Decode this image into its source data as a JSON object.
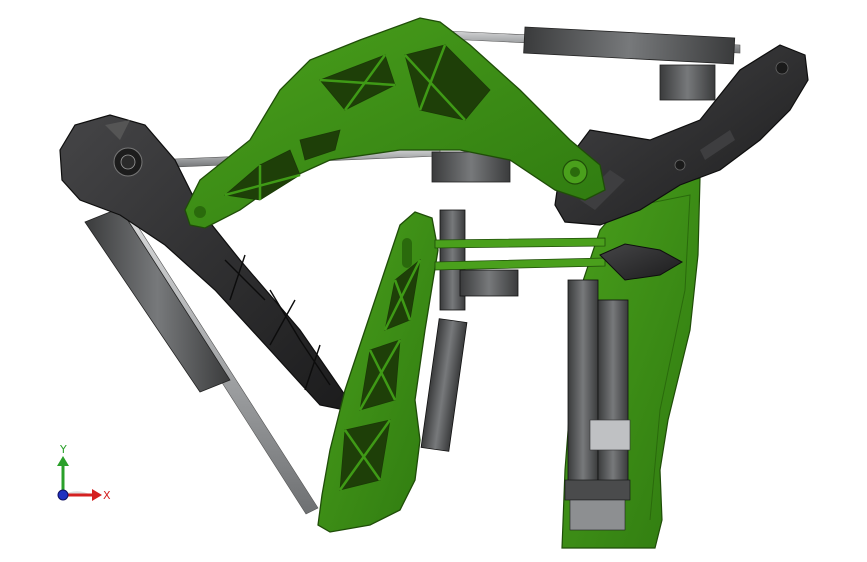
{
  "viewport": {
    "background": "#ffffff",
    "model_colors": {
      "green_frame": "#3c8c14",
      "green_dark": "#2a6a0c",
      "dark_part": "#2e2e30",
      "dark_edge": "#151515",
      "rod_grey": "#a8aaac",
      "cylinder_grey": "#5a5c5e"
    }
  },
  "triad": {
    "y_label": "Y",
    "x_label": "X",
    "y_color": "#2aa02a",
    "x_color": "#d42020",
    "z_color": "#2030c0"
  }
}
